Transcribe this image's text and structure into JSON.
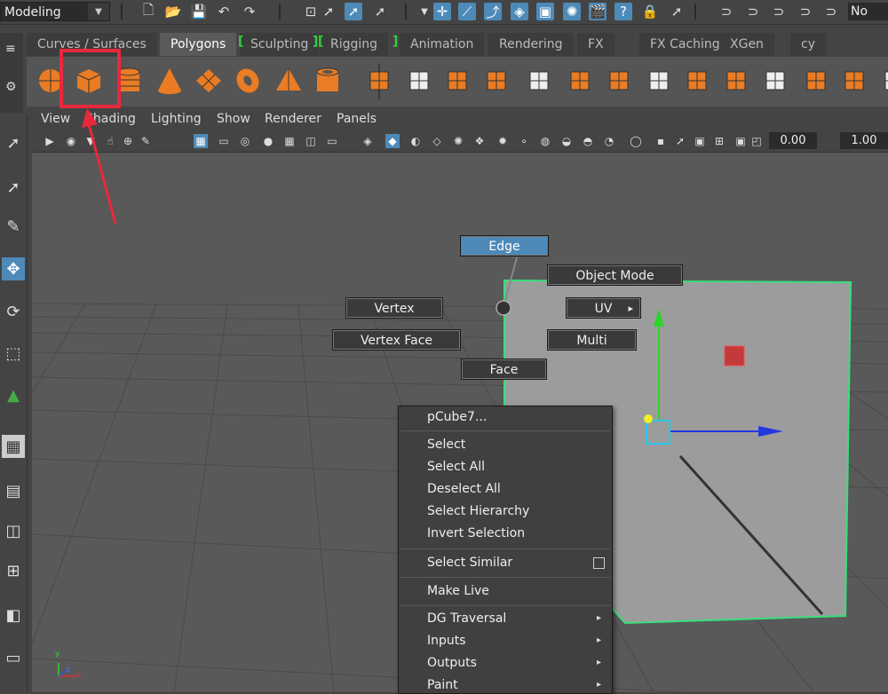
{
  "status_line": {
    "mode": "Modeling",
    "cut_label": "No"
  },
  "shelf": {
    "tabs": [
      {
        "label": "Curves / Surfaces",
        "active": false
      },
      {
        "label": "Polygons",
        "active": true
      },
      {
        "label": "Sculpting",
        "active": false
      },
      {
        "label": "Rigging",
        "active": false
      },
      {
        "label": "Animation",
        "active": false
      },
      {
        "label": "Rendering",
        "active": false
      },
      {
        "label": "FX",
        "active": false
      },
      {
        "label": "FX Caching",
        "active": false
      },
      {
        "label": "XGen",
        "active": false
      },
      {
        "label": "cy",
        "active": false
      }
    ],
    "bracket_open": "[",
    "bracket_close": "]",
    "icons": [
      "poly-sphere-icon",
      "poly-cube-icon",
      "poly-cylinder-icon",
      "poly-cone-icon",
      "poly-plane-icon",
      "poly-torus-icon",
      "poly-pyramid-icon",
      "poly-pipe-icon",
      "combine-icon",
      "separate-icon",
      "extract-icon",
      "smooth-icon",
      "bevel-icon",
      "bridge-icon",
      "extrude-icon",
      "append-icon",
      "multi-cut-icon",
      "target-weld-icon",
      "collapse-icon",
      "merge-icon",
      "mirror-icon",
      "center-pivot-icon",
      "freeze-transform-icon",
      "history-icon",
      "uv-icon",
      "flip-icon"
    ],
    "accent_color": "#e97c24"
  },
  "panel_menu": [
    "View",
    "Shading",
    "Lighting",
    "Show",
    "Renderer",
    "Panels"
  ],
  "panel_toolbar": {
    "value_a": "0.00",
    "value_b": "1.00"
  },
  "marking_menu": {
    "edge": "Edge",
    "object_mode": "Object Mode",
    "vertex": "Vertex",
    "uv": "UV",
    "uv_arrow": "▸",
    "vertex_face": "Vertex Face",
    "multi": "Multi",
    "face": "Face",
    "highlight_color": "#4d8ab8"
  },
  "context_menu": {
    "title": "pCube7...",
    "group1": [
      "Select",
      "Select All",
      "Deselect All",
      "Select Hierarchy",
      "Invert Selection"
    ],
    "select_similar": "Select Similar",
    "make_live": "Make Live",
    "submenus": [
      "DG Traversal",
      "Inputs",
      "Outputs",
      "Paint"
    ],
    "submenu_arrow": "▸"
  },
  "axis": {
    "y": "y",
    "x": "x",
    "z": "z"
  },
  "annotation": {
    "highlight_color": "#e8293c"
  }
}
